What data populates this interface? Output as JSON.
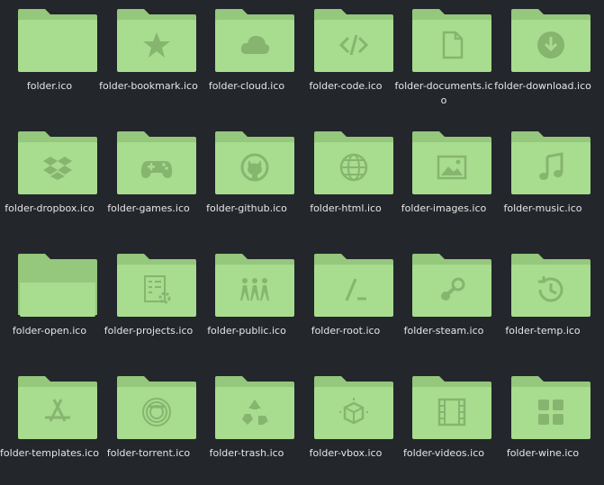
{
  "colors": {
    "background": "#23262b",
    "folder_back": "#95c77c",
    "folder_front": "#a8dc8f",
    "glyph": "#86b56f",
    "label": "#e6e6e6"
  },
  "items": [
    {
      "label": "folder.ico",
      "icon": "folder-icon"
    },
    {
      "label": "folder-bookmark.ico",
      "icon": "star-icon"
    },
    {
      "label": "folder-cloud.ico",
      "icon": "cloud-icon"
    },
    {
      "label": "folder-code.ico",
      "icon": "code-icon"
    },
    {
      "label": "folder-documents.ico",
      "icon": "document-icon"
    },
    {
      "label": "folder-download.ico",
      "icon": "download-icon"
    },
    {
      "label": "folder-dropbox.ico",
      "icon": "dropbox-icon"
    },
    {
      "label": "folder-games.ico",
      "icon": "gamepad-icon"
    },
    {
      "label": "folder-github.ico",
      "icon": "github-icon"
    },
    {
      "label": "folder-html.ico",
      "icon": "globe-icon"
    },
    {
      "label": "folder-images.ico",
      "icon": "image-icon"
    },
    {
      "label": "folder-music.ico",
      "icon": "music-note-icon"
    },
    {
      "label": "folder-open.ico",
      "icon": "folder-open-icon"
    },
    {
      "label": "folder-projects.ico",
      "icon": "projects-icon"
    },
    {
      "label": "folder-public.ico",
      "icon": "people-icon"
    },
    {
      "label": "folder-root.ico",
      "icon": "terminal-slash-icon"
    },
    {
      "label": "folder-steam.ico",
      "icon": "steam-icon"
    },
    {
      "label": "folder-temp.ico",
      "icon": "history-icon"
    },
    {
      "label": "folder-templates.ico",
      "icon": "app-store-icon"
    },
    {
      "label": "folder-torrent.ico",
      "icon": "torrent-icon"
    },
    {
      "label": "folder-trash.ico",
      "icon": "recycle-icon"
    },
    {
      "label": "folder-vbox.ico",
      "icon": "vbox-cube-icon"
    },
    {
      "label": "folder-videos.ico",
      "icon": "film-icon"
    },
    {
      "label": "folder-wine.ico",
      "icon": "grid-icon"
    }
  ]
}
